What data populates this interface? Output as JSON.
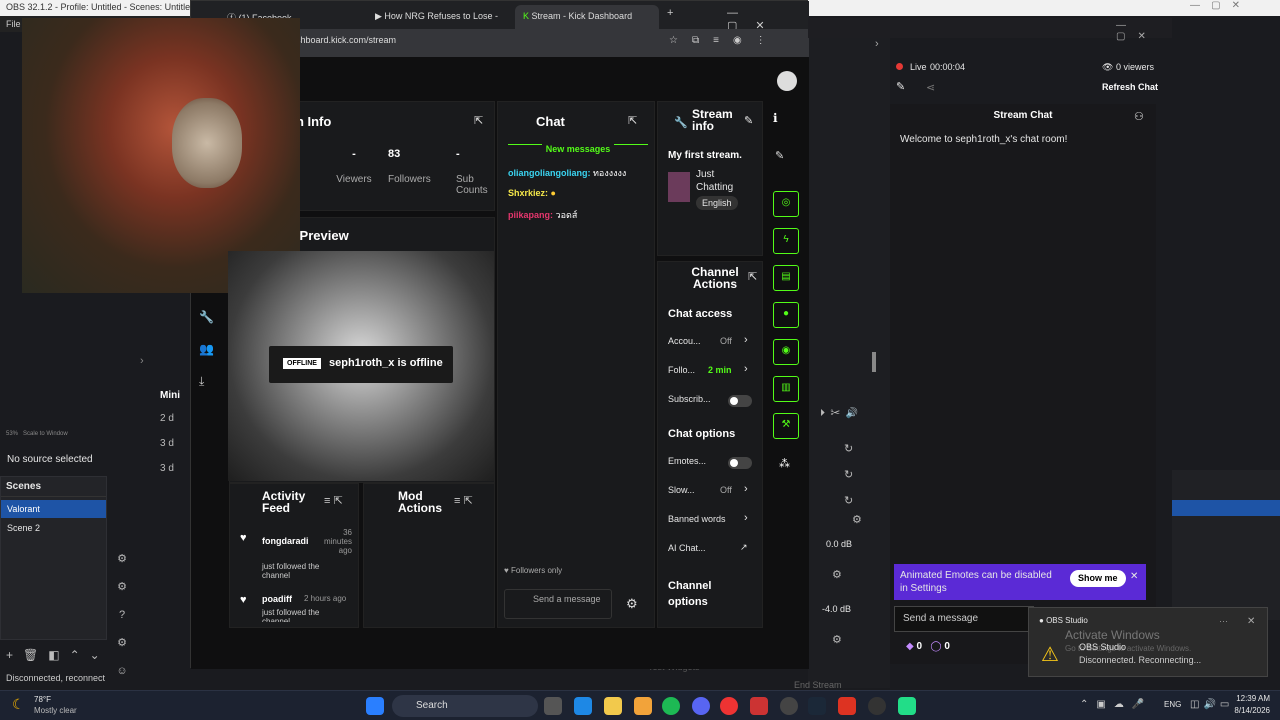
{
  "obs": {
    "title": "OBS 32.1.2 - Profile: Untitled - Scenes: Untitled",
    "menu_file": "File",
    "no_source": "No source selected",
    "scenes_header": "Scenes",
    "scenes": [
      "Valorant",
      "Scene 2"
    ],
    "mini_label": "Mini",
    "rows": [
      "2 d",
      "3 d",
      "3 d"
    ],
    "zoom": "53%",
    "scale": "Scale to Window",
    "db1": "0.0 dB",
    "db2": "-4.0 dB",
    "status": "Disconnected, reconnect",
    "test_widgets": "Test Widgets",
    "end_stream": "End Stream"
  },
  "browser": {
    "tabs": [
      "(1) Facebook",
      "How NRG Refuses to Lose -",
      "Stream - Kick Dashboard"
    ],
    "url": "ashboard.kick.com/stream"
  },
  "kick": {
    "session_title": "on Info",
    "stats": [
      {
        "value": "-",
        "label": "Viewers"
      },
      {
        "value": "83",
        "label": "Followers"
      },
      {
        "value": "-",
        "label": "Sub Counts"
      }
    ],
    "preview_title": "n Preview",
    "offline_badge": "OFFLINE",
    "offline_text": "seph1roth_x is offline",
    "activity_title": "Activity Feed",
    "activity": [
      {
        "user": "fongdaradi",
        "time": "36 minutes ago",
        "text": "just followed the channel"
      },
      {
        "user": "poadiff",
        "time": "2 hours ago",
        "text": "just followed the channel"
      }
    ],
    "mod_title": "Mod Actions",
    "chat_title": "Chat",
    "new_messages": "New messages",
    "messages": [
      {
        "user": "oliangoliangoliang",
        "text": "ทองงงงง",
        "color": "#3ad4f1"
      },
      {
        "user": "Shxrkiez",
        "text": "",
        "color": "#f6e94a"
      },
      {
        "user": "piikapang",
        "text": "วอดส์",
        "color": "#e5366d"
      }
    ],
    "followers_only": "Followers only",
    "send_placeholder": "Send a message",
    "stream_info_title": "Stream info",
    "stream_title": "My first stream.",
    "category": "Just Chatting",
    "language": "English",
    "channel_actions_title": "Channel Actions",
    "chat_access": "Chat access",
    "access_rows": [
      {
        "label": "Accou...",
        "value": "Off"
      },
      {
        "label": "Follo...",
        "value": "2 min"
      },
      {
        "label": "Subscrib...",
        "value": ""
      }
    ],
    "chat_options": "Chat options",
    "option_rows": [
      {
        "label": "Emotes...",
        "value": ""
      },
      {
        "label": "Slow...",
        "value": "Off"
      },
      {
        "label": "Banned words",
        "value": ""
      },
      {
        "label": "AI Chat...",
        "value": ""
      }
    ],
    "channel_options": "Channel options"
  },
  "rchat": {
    "live": "Live",
    "timer": "00:00:04",
    "viewers": "0 viewers",
    "refresh": "Refresh Chat",
    "title": "Stream Chat",
    "welcome": "Welcome to seph1roth_x's chat room!",
    "banner": "Animated Emotes can be disabled in Settings",
    "show_me": "Show me",
    "send": "Send a message",
    "count1": "0",
    "count2": "0"
  },
  "toast": {
    "app": "OBS Studio",
    "watermark": "Activate Windows",
    "watermark2": "Go to Settings to activate Windows.",
    "title": "OBS Studio",
    "msg": "Disconnected. Reconnecting..."
  },
  "taskbar": {
    "temp": "78°F",
    "weather": "Mostly clear",
    "search": "Search",
    "lang": "ENG",
    "time": "12:39 AM",
    "date": "8/14/2026"
  }
}
